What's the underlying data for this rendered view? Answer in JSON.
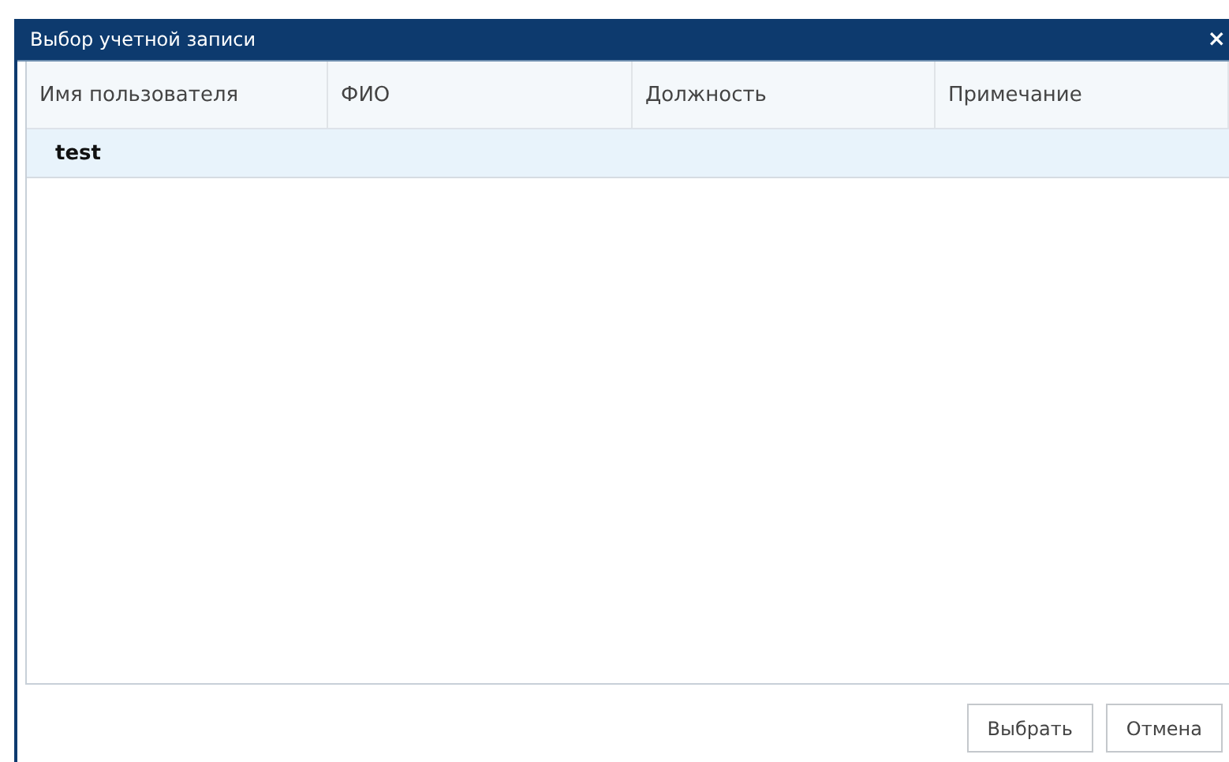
{
  "window": {
    "title": "Выбор учетной записи",
    "close": "×"
  },
  "table": {
    "columns": [
      "Имя пользователя",
      "ФИО",
      "Должность",
      "Примечание"
    ],
    "rows": [
      {
        "cells": [
          "test"
        ],
        "selected": true
      }
    ]
  },
  "buttons": [
    "Выбрать",
    "Отмена"
  ]
}
